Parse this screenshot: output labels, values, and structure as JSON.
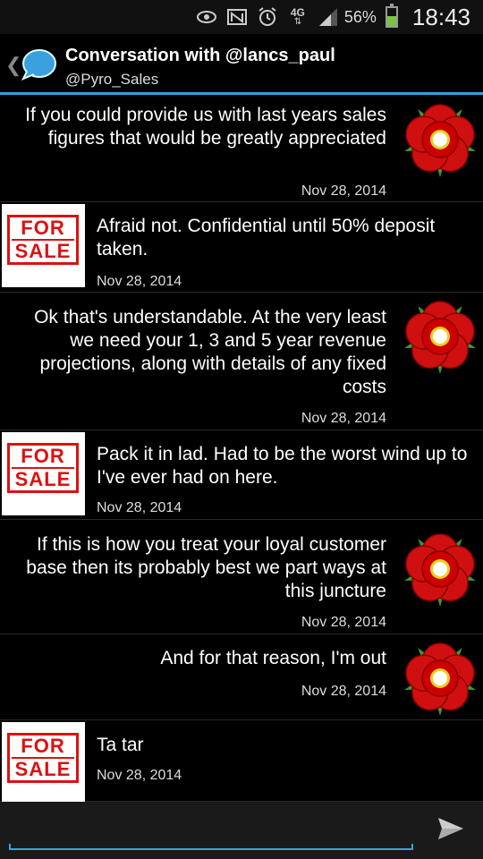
{
  "status_bar": {
    "icons": [
      "eye-icon",
      "nfc-icon",
      "alarm-icon",
      "4g-icon",
      "signal-icon"
    ],
    "network": "4G",
    "battery_percent": "56%",
    "battery_level": 0.56,
    "time": "18:43"
  },
  "header": {
    "title": "Conversation with @lancs_paul",
    "subtitle": "@Pyro_Sales",
    "accent_color": "#33a5d9"
  },
  "messages": [
    {
      "direction": "sent",
      "text": "If you could provide us with last years sales figures that would be greatly appreciated",
      "date": "Nov 28, 2014"
    },
    {
      "direction": "received",
      "text": "Afraid not. Confidential until 50% deposit taken.",
      "date": "Nov 28, 2014"
    },
    {
      "direction": "sent",
      "text": "Ok that's understandable. At the very least we need your 1, 3 and 5 year revenue projections, along with details of any fixed costs",
      "date": "Nov 28, 2014"
    },
    {
      "direction": "received",
      "text": "Pack it in lad. Had to be the worst wind up to I've ever had on here.",
      "date": "Nov 28, 2014"
    },
    {
      "direction": "sent",
      "text": "If this is how you treat your loyal customer base then its probably best we part ways at this juncture",
      "date": "Nov 28, 2014"
    },
    {
      "direction": "sent",
      "text": "And for that reason, I'm out",
      "date": "Nov 28, 2014"
    },
    {
      "direction": "received",
      "text": "Ta tar",
      "date": "Nov 28, 2014"
    }
  ],
  "avatar_sign": {
    "line1": "FOR",
    "line2": "SALE"
  },
  "compose": {
    "placeholder": "",
    "send_icon": "send-icon"
  }
}
